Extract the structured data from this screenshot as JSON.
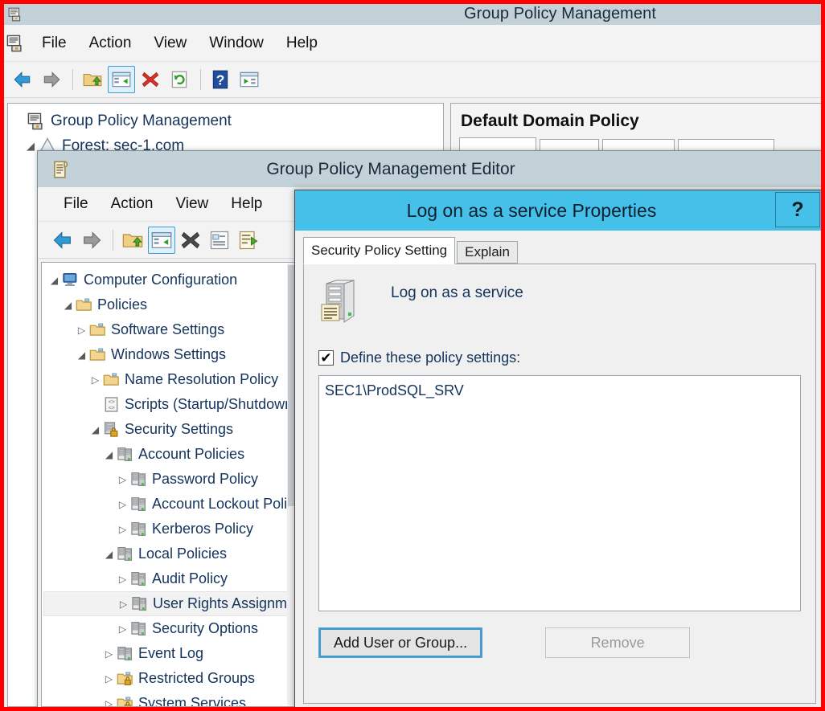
{
  "window_gpmc": {
    "title": "Group Policy Management",
    "app_icon": "gpmc-console-icon",
    "menu": [
      {
        "label": "File"
      },
      {
        "label": "Action"
      },
      {
        "label": "View"
      },
      {
        "label": "Window"
      },
      {
        "label": "Help"
      }
    ],
    "toolbar": [
      {
        "name": "back-icon"
      },
      {
        "name": "forward-icon"
      },
      {
        "name": "up-folder-icon"
      },
      {
        "name": "show-hide-tree-icon"
      },
      {
        "name": "delete-icon"
      },
      {
        "name": "refresh-icon"
      },
      {
        "name": "help-icon"
      },
      {
        "name": "export-list-icon"
      }
    ],
    "tree": [
      {
        "label": "Group Policy Management",
        "icon": "gpmc-console-icon",
        "arrow": "",
        "indent": 0
      },
      {
        "label": "Forest: sec-1.com",
        "icon": "forest-icon",
        "arrow": "◢",
        "indent": 1
      }
    ],
    "right_pane": {
      "header": "Default Domain Policy",
      "tabs": [
        {
          "label": ""
        },
        {
          "label": ""
        },
        {
          "label": ""
        },
        {
          "label": ""
        }
      ]
    }
  },
  "window_gpme": {
    "title": "Group Policy Management Editor",
    "app_icon": "gpo-scroll-icon",
    "menu": [
      {
        "label": "File"
      },
      {
        "label": "Action"
      },
      {
        "label": "View"
      },
      {
        "label": "Help"
      }
    ],
    "toolbar": [
      {
        "name": "back-icon"
      },
      {
        "name": "forward-icon"
      },
      {
        "name": "up-folder-icon"
      },
      {
        "name": "show-hide-tree-icon"
      },
      {
        "name": "delete-icon"
      },
      {
        "name": "properties-icon"
      },
      {
        "name": "export-list-icon"
      }
    ],
    "tree": [
      {
        "label": "Computer Configuration",
        "icon": "computer-icon",
        "arrow": "◢",
        "indent": 0,
        "selected": false
      },
      {
        "label": "Policies",
        "icon": "folder-icon",
        "arrow": "◢",
        "indent": 1,
        "selected": false
      },
      {
        "label": "Software Settings",
        "icon": "folder-icon",
        "arrow": "▷",
        "indent": 2,
        "selected": false
      },
      {
        "label": "Windows Settings",
        "icon": "folder-icon",
        "arrow": "◢",
        "indent": 2,
        "selected": false
      },
      {
        "label": "Name Resolution Policy",
        "icon": "folder-icon",
        "arrow": "▷",
        "indent": 3,
        "selected": false
      },
      {
        "label": "Scripts (Startup/Shutdown)",
        "icon": "script-icon",
        "arrow": "",
        "indent": 3,
        "selected": false
      },
      {
        "label": "Security Settings",
        "icon": "security-lock-icon",
        "arrow": "◢",
        "indent": 3,
        "selected": false
      },
      {
        "label": "Account Policies",
        "icon": "policy-icon",
        "arrow": "◢",
        "indent": 4,
        "selected": false
      },
      {
        "label": "Password Policy",
        "icon": "policy-icon",
        "arrow": "▷",
        "indent": 5,
        "selected": false
      },
      {
        "label": "Account Lockout Policy",
        "icon": "policy-icon",
        "arrow": "▷",
        "indent": 5,
        "selected": false
      },
      {
        "label": "Kerberos Policy",
        "icon": "policy-icon",
        "arrow": "▷",
        "indent": 5,
        "selected": false
      },
      {
        "label": "Local Policies",
        "icon": "policy-icon",
        "arrow": "◢",
        "indent": 4,
        "selected": false
      },
      {
        "label": "Audit Policy",
        "icon": "policy-icon",
        "arrow": "▷",
        "indent": 5,
        "selected": false
      },
      {
        "label": "User Rights Assignment",
        "icon": "policy-icon",
        "arrow": "▷",
        "indent": 5,
        "selected": true
      },
      {
        "label": "Security Options",
        "icon": "policy-icon",
        "arrow": "▷",
        "indent": 5,
        "selected": false
      },
      {
        "label": "Event Log",
        "icon": "policy-icon",
        "arrow": "▷",
        "indent": 4,
        "selected": false
      },
      {
        "label": "Restricted Groups",
        "icon": "folder-lock-icon",
        "arrow": "▷",
        "indent": 4,
        "selected": false
      },
      {
        "label": "System Services",
        "icon": "folder-lock-icon",
        "arrow": "▷",
        "indent": 4,
        "selected": false
      }
    ]
  },
  "dialog": {
    "title": "Log on as a service Properties",
    "help_button": "?",
    "tabs": [
      {
        "label": "Security Policy Setting",
        "selected": true
      },
      {
        "label": "Explain",
        "selected": false
      }
    ],
    "policy_icon": "server-policy-icon",
    "policy_name": "Log on as a service",
    "define_checkbox": {
      "label": "Define these policy settings:",
      "checked": true,
      "check_glyph": "✔"
    },
    "list_items": [
      "SEC1\\ProdSQL_SRV"
    ],
    "buttons": [
      {
        "label": "Add User or Group...",
        "state": "focused"
      },
      {
        "label": "Remove",
        "state": "disabled"
      }
    ]
  },
  "colors": {
    "dialog_titlebar": "#45c0e8",
    "window_titlebar": "#c3d2d9",
    "annotation_border": "#ff0000",
    "tree_text": "#14335c",
    "focus_outline": "#3c9ad4"
  }
}
